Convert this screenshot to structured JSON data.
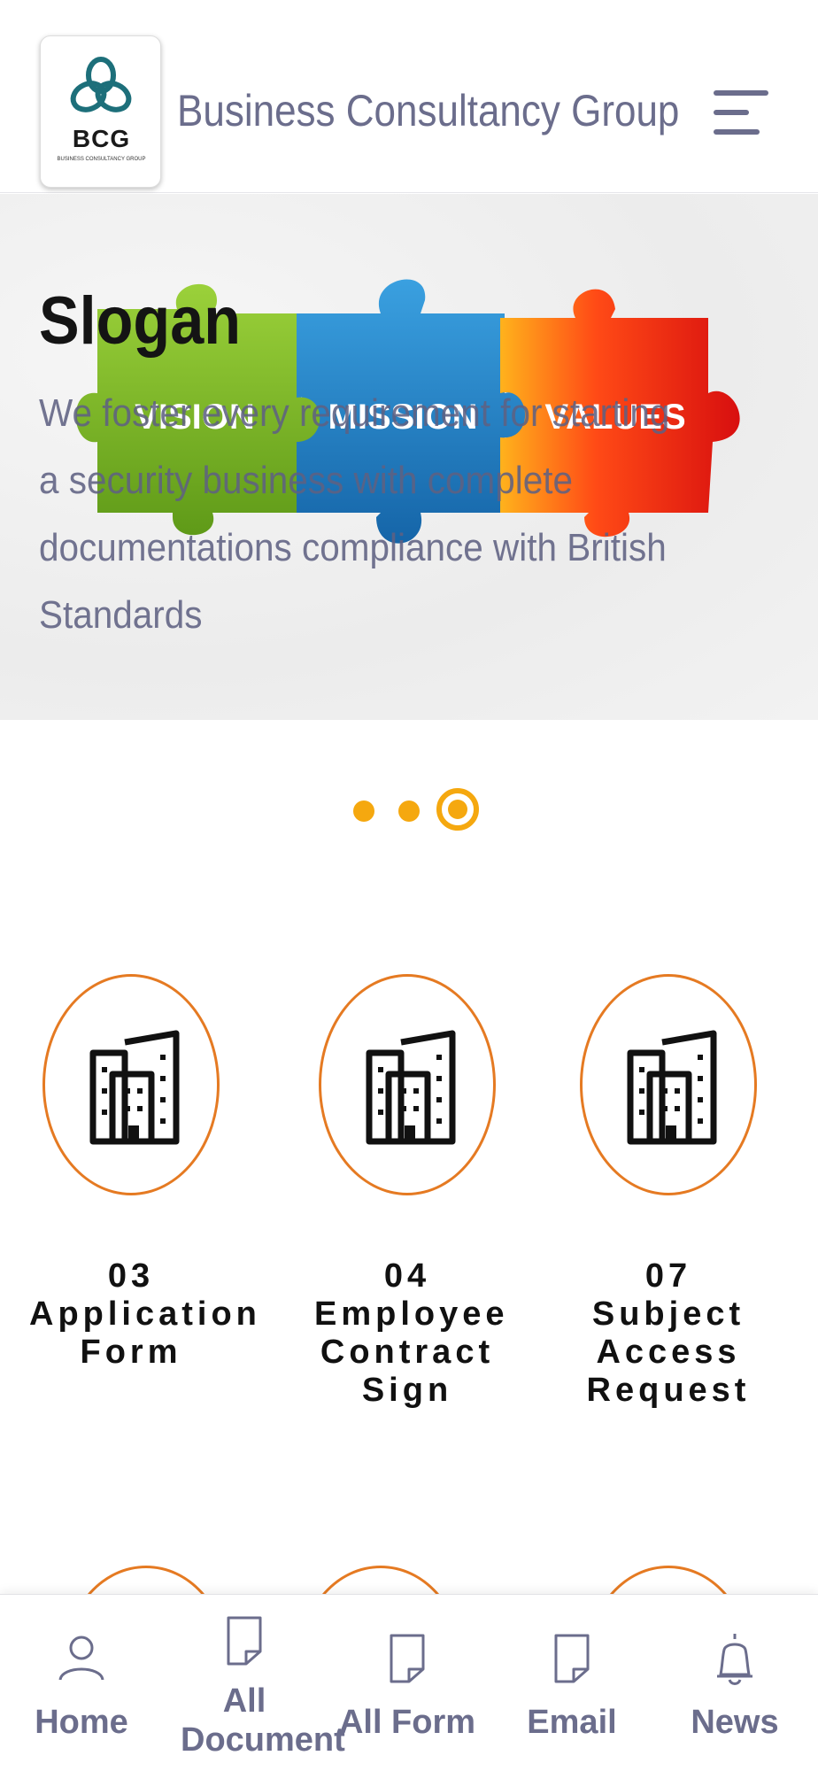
{
  "header": {
    "logo_text": "BCG",
    "logo_subtext": "BUSINESS CONSULTANCY GROUP",
    "title": "Business Consultancy Group",
    "menu_icon": "hamburger-menu-icon"
  },
  "banner": {
    "slogan_title": "Slogan",
    "slogan_text": "We foster every requirement for starting a security business with complete documentations compliance with British Standards",
    "puzzle_labels": [
      "VISION",
      "MISSION",
      "VALUES"
    ]
  },
  "carousel": {
    "dot_count": 3,
    "active_index": 3
  },
  "cards": [
    {
      "number": "03",
      "label": "Application Form",
      "icon": "office-building-icon"
    },
    {
      "number": "04",
      "label": "Employee Contract Sign",
      "icon": "office-building-icon"
    },
    {
      "number": "07",
      "label": "Subject Access Request",
      "icon": "office-building-icon"
    }
  ],
  "bottom_nav": [
    {
      "label": "Home",
      "icon": "user-icon"
    },
    {
      "label": "All Document",
      "icon": "document-icon"
    },
    {
      "label": "All Form",
      "icon": "document-icon"
    },
    {
      "label": "Email",
      "icon": "document-icon"
    },
    {
      "label": "News",
      "icon": "bell-icon"
    }
  ],
  "colors": {
    "accent_orange": "#f5a80f",
    "circle_orange": "#e57a22",
    "nav_text": "#6b6d8c",
    "title_text": "#6b6d8c"
  }
}
